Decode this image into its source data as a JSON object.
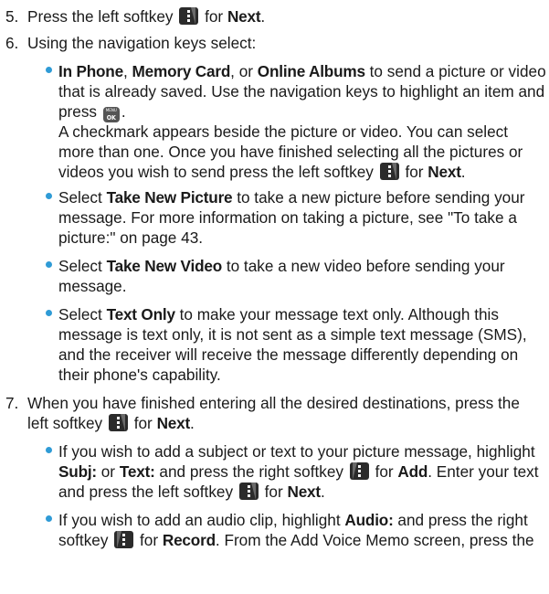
{
  "step5": {
    "num": "5.",
    "pre": "Press the left softkey",
    "for": "for",
    "next": "Next",
    "period": "."
  },
  "step6": {
    "num": "6.",
    "text": "Using the navigation keys select:",
    "b1": {
      "in_phone": "In Phone",
      "c1": ",",
      "memory_card": "Memory Card",
      "or": ", or",
      "online_albums": "Online Albums",
      "l1_rest": "to send a picture or video",
      "l2": "that is already saved. Use the navigation keys to highlight an item and",
      "l3_pre": "press",
      "l3_post": ".",
      "l4": "A checkmark appears beside the picture or video. You can select",
      "l5": "more than one. Once you have finished selecting all the pictures or",
      "l6_pre": "videos you wish to send press the left softkey",
      "l6_for": "for",
      "l6_next": "Next",
      "l6_post": "."
    },
    "b2": {
      "select": "Select",
      "bold": "Take New Picture",
      "l1_rest": "to take a new picture before sending your",
      "l2": "message. For more information on taking a picture, see \"To take a",
      "l3": "picture:\" on page 43."
    },
    "b3": {
      "select": "Select",
      "bold": "Take New Video",
      "l1_rest": "to take a new video before sending your",
      "l2": "message."
    },
    "b4": {
      "select": "Select",
      "bold": "Text Only",
      "l1_rest": "to make your message text only. Although this",
      "l2": "message is text only, it is not sent as a simple text message (SMS),",
      "l3": "and the receiver will receive the message differently depending on",
      "l4": "their phone's capability."
    }
  },
  "step7": {
    "num": "7.",
    "l1": "When you have finished entering all the desired destinations, press the",
    "l2_pre": "left softkey",
    "l2_for": "for",
    "l2_next": "Next",
    "l2_post": ".",
    "b1": {
      "l1": "If you wish to add a subject or text to your picture message, highlight",
      "subj": "Subj:",
      "or": "or",
      "text": "Text:",
      "l2_mid": "and press the right softkey",
      "l2_for": "for",
      "add": "Add",
      "l2_post": ". Enter your text",
      "l3_pre": "and press the left softkey",
      "l3_for": "for",
      "next": "Next",
      "l3_post": "."
    },
    "b2": {
      "l1_pre": "If you wish to add an audio clip, highlight",
      "audio": "Audio:",
      "l1_post": "and press the right",
      "l2_pre": "softkey",
      "l2_for": "for",
      "record": "Record",
      "l2_post": ". From the Add Voice Memo screen, press the"
    }
  },
  "icons": {
    "softkey": "softkey-icon",
    "menu_ok": "menu-ok-icon",
    "menu_ok_top": "MENU",
    "menu_ok_bottom": "OK"
  },
  "colors": {
    "bullet": "#2f9bd6",
    "text": "#1a1a1a"
  }
}
